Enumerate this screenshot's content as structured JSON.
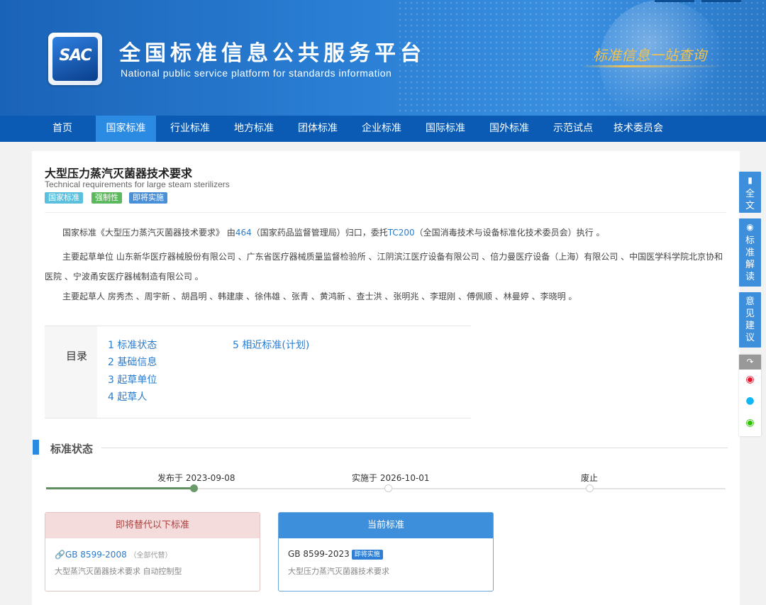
{
  "header": {
    "logo_text": "SAC",
    "title": "全国标准信息公共服务平台",
    "subtitle": "National public service platform  for standards information",
    "slogan": "标准信息一站查询"
  },
  "nav": {
    "items": [
      "首页",
      "国家标准",
      "行业标准",
      "地方标准",
      "团体标准",
      "企业标准",
      "国际标准",
      "国外标准",
      "示范试点",
      "技术委员会"
    ],
    "active": "国家标准"
  },
  "standard": {
    "title": "大型压力蒸汽灭菌器技术要求",
    "title_en": "Technical requirements for large steam sterilizers",
    "badges": [
      {
        "label": "国家标准",
        "color": "#5bc0de"
      },
      {
        "label": "强制性",
        "color": "#5cb85c"
      },
      {
        "label": "即将实施",
        "color": "#4a90d9"
      }
    ]
  },
  "description": {
    "p1_prefix": "国家标准《大型压力蒸汽灭菌器技术要求》 由",
    "p1_link1": "464",
    "p1_mid": "（国家药品监督管理局）归口，委托",
    "p1_link2": "TC200",
    "p1_suffix": "（全国消毒技术与设备标准化技术委员会）执行 。",
    "p2": "主要起草单位 山东新华医疗器械股份有限公司 、广东省医疗器械质量监督检验所 、江阴滨江医疗设备有限公司 、倍力曼医疗设备（上海）有限公司 、中国医学科学院北京协和医院 、宁波甬安医疗器械制造有限公司 。",
    "p3": "主要起草人 房秀杰 、周宇新 、胡昌明 、韩建康 、徐伟雄 、张青 、黄鸿新 、查士洪 、张明兆 、李琨刚 、傅佩顺 、林曼婷 、李晓明 。"
  },
  "toc": {
    "label": "目录",
    "items": [
      "1  标准状态",
      "2  基础信息",
      "3  起草单位",
      "4  起草人",
      "5  相近标准(计划)"
    ]
  },
  "status_section": {
    "title": "标准状态",
    "timeline": [
      {
        "label": "发布于 2023-09-08",
        "done": true
      },
      {
        "label": "实施于 2026-10-01",
        "done": false
      },
      {
        "label": "废止",
        "done": false
      }
    ]
  },
  "cards": {
    "replace": {
      "header": "即将替代以下标准",
      "code": "GB 8599-2008",
      "note": "（全部代替）",
      "desc": "大型蒸汽灭菌器技术要求 自动控制型"
    },
    "current": {
      "header": "当前标准",
      "code": "GB 8599-2023",
      "badge": "即将实施",
      "desc": "大型压力蒸汽灭菌器技术要求"
    }
  },
  "sidebar": {
    "buttons": [
      {
        "icon": "document-icon",
        "label": "全文"
      },
      {
        "icon": "target-icon",
        "label": "标准解读"
      },
      {
        "icon": "",
        "label": "意见建议"
      }
    ],
    "share": {
      "icon": "share-icon",
      "targets": [
        "weibo-icon",
        "qq-icon",
        "wechat-icon"
      ]
    }
  },
  "colors": {
    "primary": "#0b5bb5",
    "accent": "#2b8be3",
    "link": "#2a7ccf",
    "warning_bg": "#f4dcdc"
  }
}
